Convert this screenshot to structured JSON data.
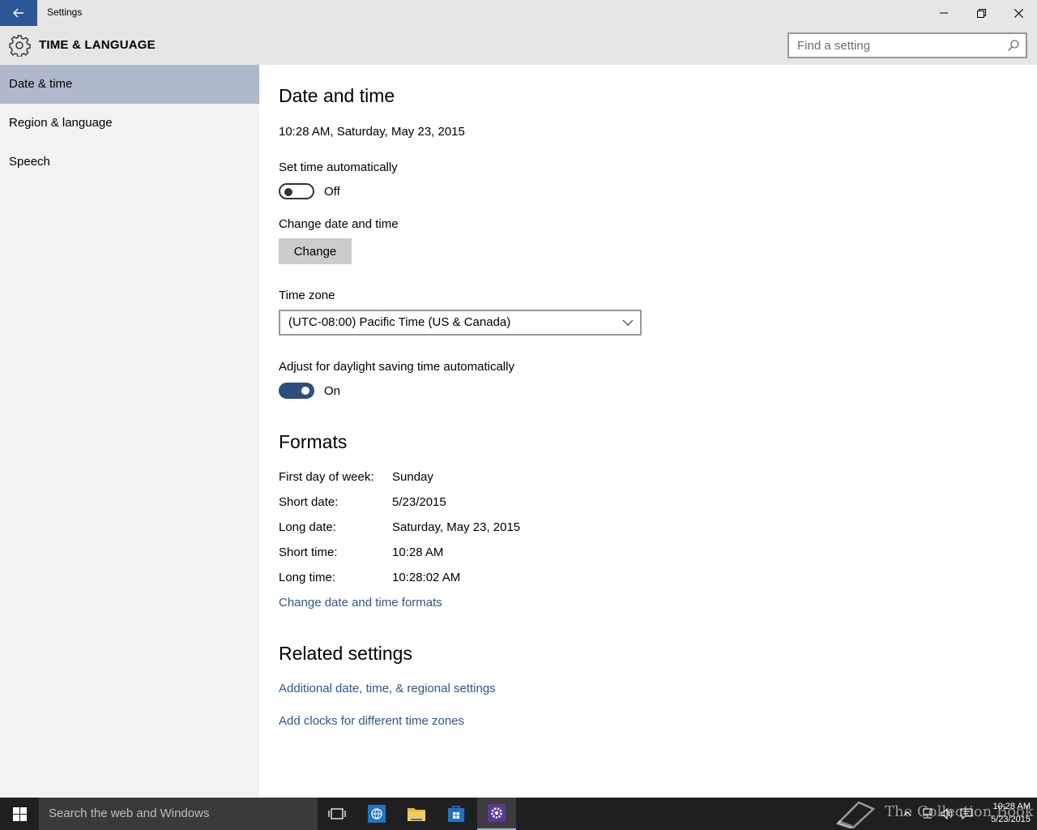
{
  "window": {
    "title": "Settings"
  },
  "header": {
    "section_title": "TIME & LANGUAGE",
    "search_placeholder": "Find a setting"
  },
  "sidebar": {
    "items": [
      {
        "label": "Date & time",
        "active": true
      },
      {
        "label": "Region & language",
        "active": false
      },
      {
        "label": "Speech",
        "active": false
      }
    ]
  },
  "main": {
    "heading": "Date and time",
    "current_datetime": "10:28 AM, Saturday, May 23, 2015",
    "set_time_auto": {
      "label": "Set time automatically",
      "state": "Off"
    },
    "change_dt": {
      "label": "Change date and time",
      "button": "Change"
    },
    "time_zone": {
      "label": "Time zone",
      "value": "(UTC-08:00) Pacific Time (US & Canada)"
    },
    "dst": {
      "label": "Adjust for daylight saving time automatically",
      "state": "On"
    },
    "formats": {
      "heading": "Formats",
      "rows": [
        {
          "label": "First day of week:",
          "value": "Sunday"
        },
        {
          "label": "Short date:",
          "value": "5/23/2015"
        },
        {
          "label": "Long date:",
          "value": "Saturday, May 23, 2015"
        },
        {
          "label": "Short time:",
          "value": "10:28 AM"
        },
        {
          "label": "Long time:",
          "value": "10:28:02 AM"
        }
      ],
      "change_link": "Change date and time formats"
    },
    "related": {
      "heading": "Related settings",
      "links": [
        "Additional date, time, & regional settings",
        "Add clocks for different time zones"
      ]
    }
  },
  "taskbar": {
    "search_placeholder": "Search the web and Windows",
    "clock_time": "10:28 AM",
    "clock_date": "5/23/2015",
    "watermark": "The Collection Book"
  },
  "colors": {
    "accent": "#2b5797",
    "toggle_on": "#2b4f7e",
    "sidebar_active": "#aebacb",
    "taskbar": "#1f1f1f"
  }
}
